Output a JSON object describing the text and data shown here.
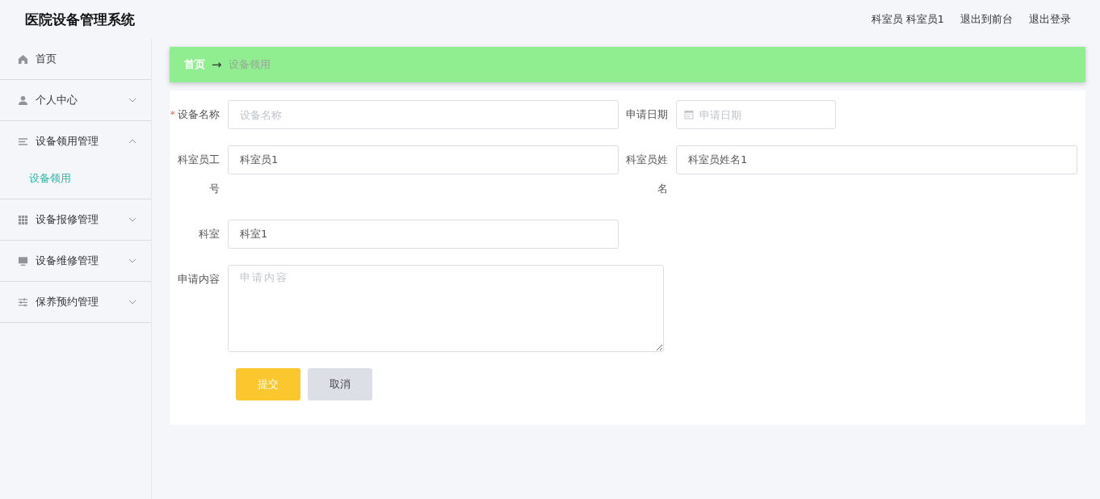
{
  "header": {
    "title": "医院设备管理系统",
    "user": "科室员 科室员1",
    "links": [
      "退出到前台",
      "退出登录"
    ]
  },
  "sidebar": {
    "items": [
      {
        "kind": "link",
        "label": "首页"
      },
      {
        "kind": "group",
        "label": "个人中心",
        "expanded": false
      },
      {
        "kind": "group",
        "label": "设备领用管理",
        "expanded": true,
        "children": [
          {
            "label": "设备领用",
            "selected": true
          }
        ]
      },
      {
        "kind": "group",
        "label": "设备报修管理",
        "expanded": false
      },
      {
        "kind": "group",
        "label": "设备维修管理",
        "expanded": false
      },
      {
        "kind": "group",
        "label": "保养预约管理",
        "expanded": false
      }
    ]
  },
  "breadcrumb": {
    "home": "首页",
    "separator": "→",
    "current": "设备领用"
  },
  "form": {
    "rows": [
      [
        {
          "kind": "text",
          "label": "设备名称",
          "mark": "*",
          "placeholder": "设备名称"
        },
        {
          "kind": "date",
          "label": "申请日期",
          "placeholder": "申请日期"
        }
      ],
      [
        {
          "kind": "text",
          "label": "科室员工号",
          "value": "科室员1"
        },
        {
          "kind": "text",
          "label": "科室员姓名",
          "value": "科室员姓名1"
        }
      ],
      [
        {
          "kind": "text",
          "label": "科室",
          "value": "科室1"
        }
      ],
      [
        {
          "kind": "textarea",
          "label": "申请内容",
          "placeholder": "申请内容"
        }
      ]
    ],
    "buttons": [
      {
        "kind": "primary",
        "label": "提交"
      },
      {
        "kind": "secondary",
        "label": "取消"
      }
    ]
  }
}
